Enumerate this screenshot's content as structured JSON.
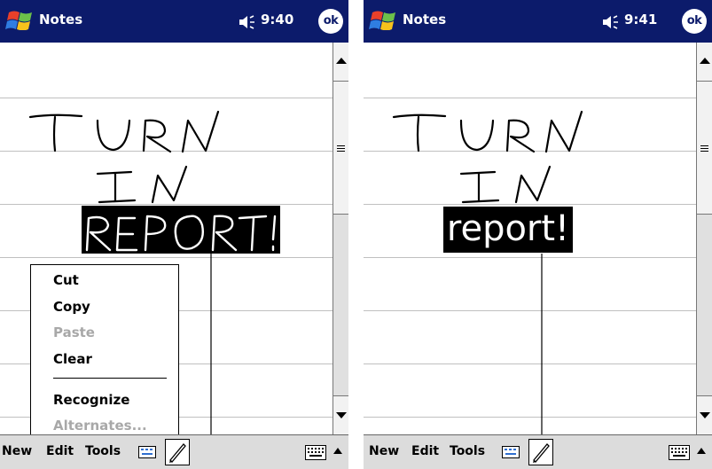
{
  "left_screen": {
    "app_title": "Notes",
    "time": "9:40",
    "ok_label": "ok",
    "context_menu": {
      "items": [
        {
          "label": "Cut",
          "enabled": true
        },
        {
          "label": "Copy",
          "enabled": true
        },
        {
          "label": "Paste",
          "enabled": false
        },
        {
          "label": "Clear",
          "enabled": true
        },
        {
          "label": "Recognize",
          "enabled": true
        },
        {
          "label": "Alternates...",
          "enabled": false
        }
      ]
    },
    "menubar": {
      "new": "New",
      "edit": "Edit",
      "tools": "Tools"
    }
  },
  "right_screen": {
    "app_title": "Notes",
    "time": "9:41",
    "ok_label": "ok",
    "recognized_text": "report!",
    "menubar": {
      "new": "New",
      "edit": "Edit",
      "tools": "Tools"
    }
  },
  "colors": {
    "titlebar": "#0c1b6b",
    "selection": "#000000",
    "disabled_text": "#a8a8a8",
    "menubar": "#dcdcdc"
  },
  "icons": [
    "windows-flag-icon",
    "speaker-icon",
    "small-keyboard-icon",
    "pen-icon",
    "keyboard-icon",
    "sip-arrow-icon"
  ]
}
